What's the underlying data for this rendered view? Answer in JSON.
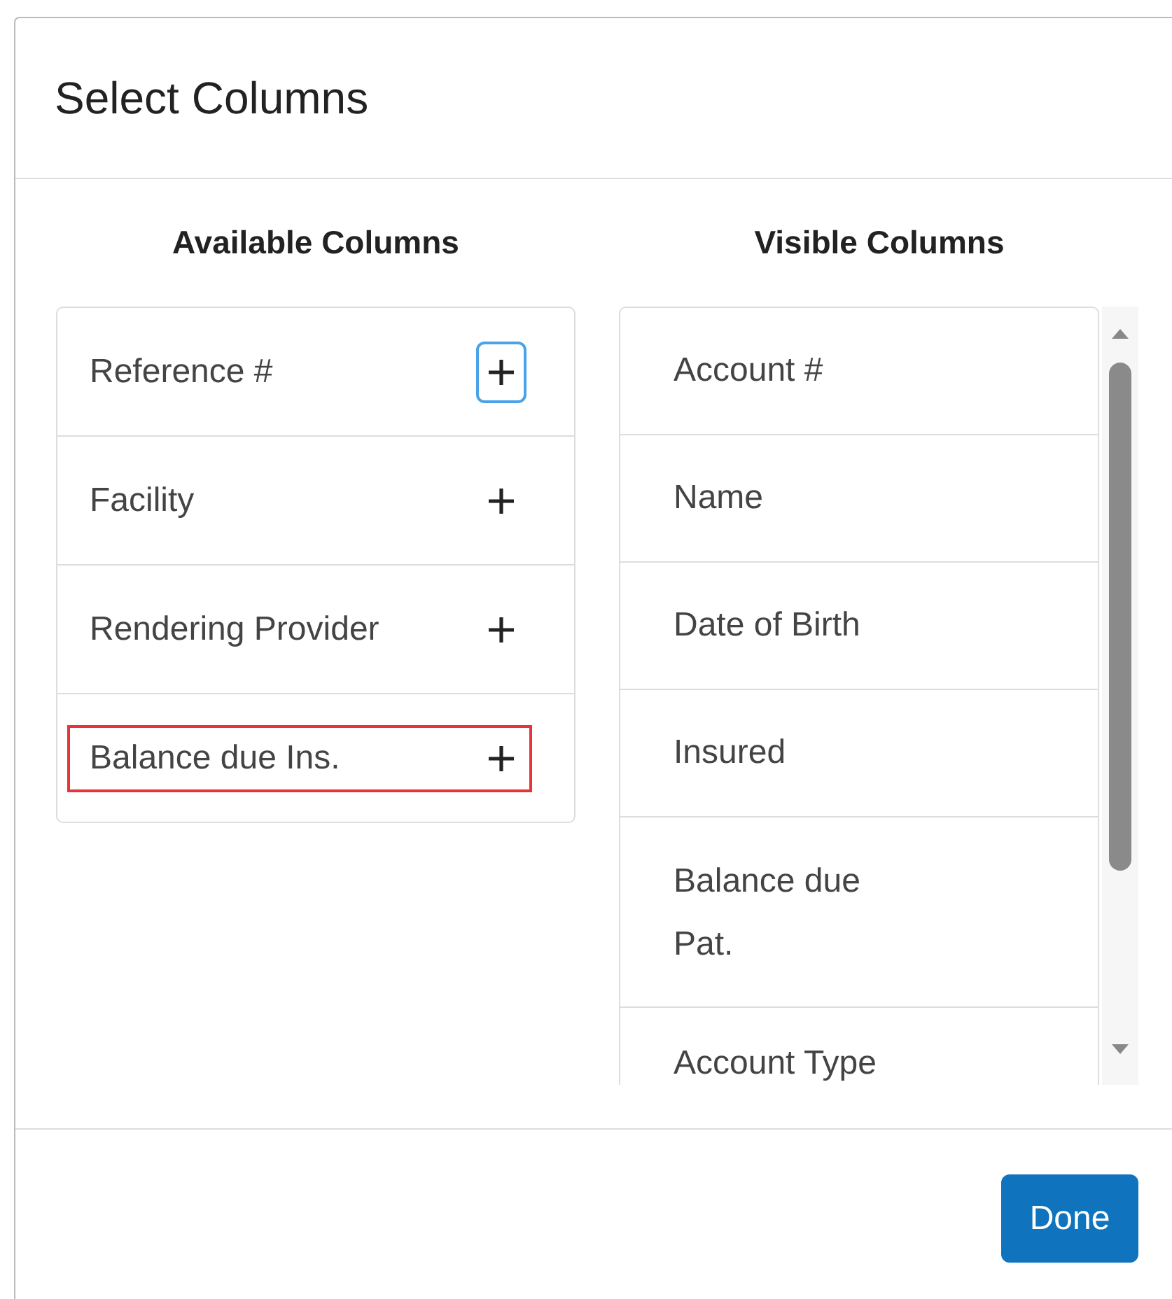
{
  "dialog": {
    "title": "Select Columns"
  },
  "available": {
    "heading": "Available Columns",
    "items": [
      {
        "label": "Reference #",
        "focused": true,
        "highlighted": false
      },
      {
        "label": "Facility",
        "focused": false,
        "highlighted": false
      },
      {
        "label": "Rendering Provider",
        "focused": false,
        "highlighted": false
      },
      {
        "label": "Balance due Ins.",
        "focused": false,
        "highlighted": true
      }
    ]
  },
  "visible": {
    "heading": "Visible Columns",
    "items": [
      {
        "label": "Account #"
      },
      {
        "label": "Name"
      },
      {
        "label": "Date of Birth"
      },
      {
        "label": "Insured"
      },
      {
        "label": "Balance due Pat."
      },
      {
        "label": "Account Type"
      }
    ]
  },
  "buttons": [
    {
      "label": "Done"
    }
  ]
}
